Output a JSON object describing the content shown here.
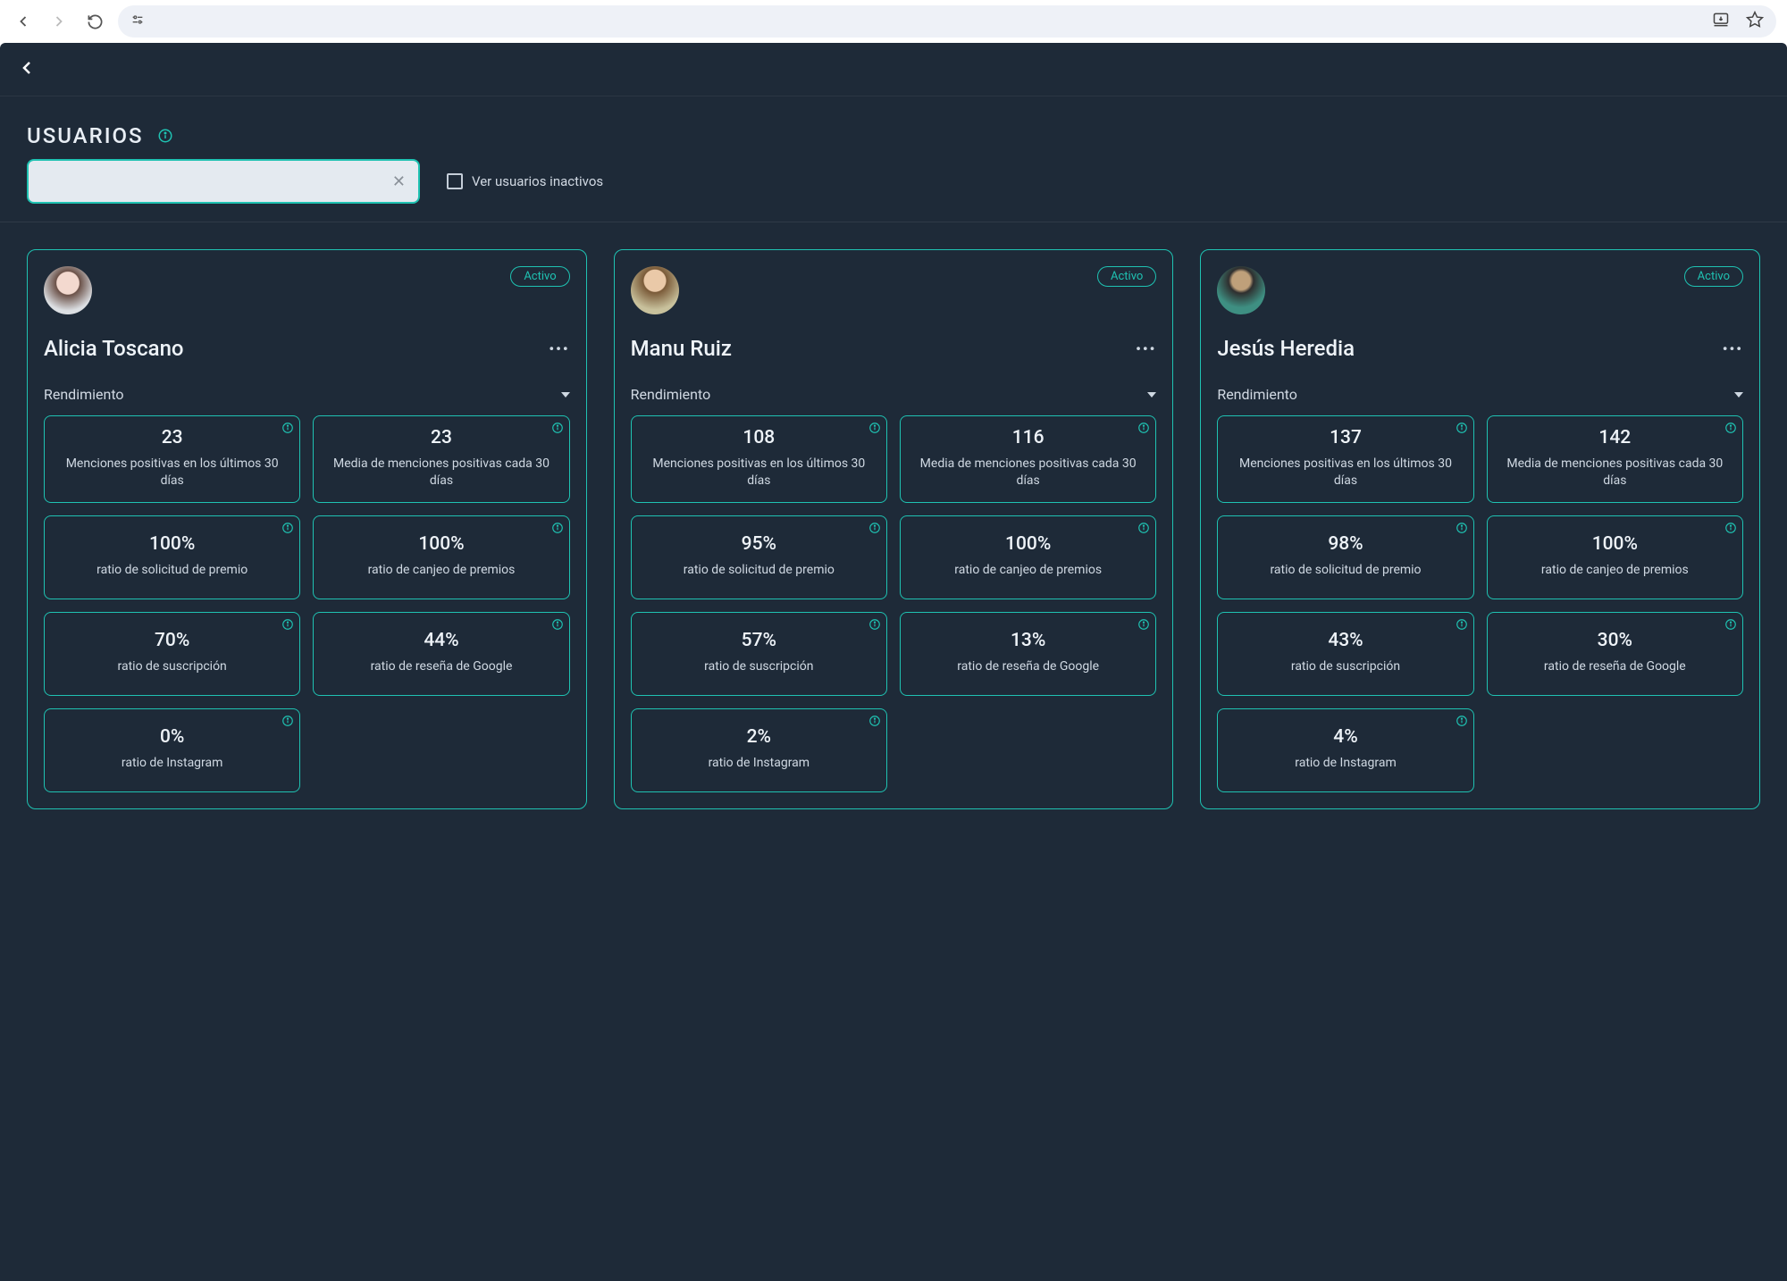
{
  "page": {
    "title": "USUARIOS",
    "search_value": "",
    "inactive_checkbox_label": "Ver usuarios inactivos"
  },
  "labels": {
    "section": "Rendimiento",
    "status_active": "Activo",
    "metrics": {
      "pos_mentions_30": "Menciones positivas en los últimos 30 días",
      "avg_pos_mentions_30": "Media de menciones positivas cada 30 días",
      "prize_request_ratio": "ratio de solicitud de premio",
      "prize_redeem_ratio": "ratio de canjeo de premios",
      "subscription_ratio": "ratio de suscripción",
      "google_review_ratio": "ratio de reseña de Google",
      "instagram_ratio": "ratio de Instagram"
    }
  },
  "users": [
    {
      "name": "Alicia Toscano",
      "status": "Activo",
      "metrics": {
        "pos_mentions_30": "23",
        "avg_pos_mentions_30": "23",
        "prize_request_ratio": "100%",
        "prize_redeem_ratio": "100%",
        "subscription_ratio": "70%",
        "google_review_ratio": "44%",
        "instagram_ratio": "0%"
      }
    },
    {
      "name": "Manu Ruiz",
      "status": "Activo",
      "metrics": {
        "pos_mentions_30": "108",
        "avg_pos_mentions_30": "116",
        "prize_request_ratio": "95%",
        "prize_redeem_ratio": "100%",
        "subscription_ratio": "57%",
        "google_review_ratio": "13%",
        "instagram_ratio": "2%"
      }
    },
    {
      "name": "Jesús Heredia",
      "status": "Activo",
      "metrics": {
        "pos_mentions_30": "137",
        "avg_pos_mentions_30": "142",
        "prize_request_ratio": "98%",
        "prize_redeem_ratio": "100%",
        "subscription_ratio": "43%",
        "google_review_ratio": "30%",
        "instagram_ratio": "4%"
      }
    }
  ]
}
